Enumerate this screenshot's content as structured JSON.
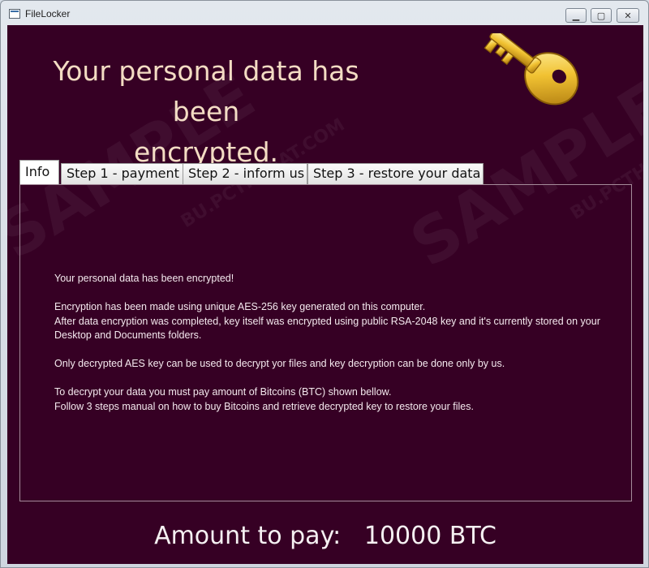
{
  "window": {
    "title": "FileLocker",
    "controls": {
      "minimize": "▁",
      "maximize": "▢",
      "close": "✕"
    }
  },
  "header": {
    "headline_line1": "Your personal data has been",
    "headline_line2": "encrypted."
  },
  "tabs": [
    {
      "label": "Info",
      "active": true
    },
    {
      "label": "Step 1 - payment",
      "active": false
    },
    {
      "label": "Step 2 - inform us",
      "active": false
    },
    {
      "label": "Step 3 - restore your data",
      "active": false
    }
  ],
  "info_panel": {
    "p1": "Your personal data has been encrypted!",
    "p2a": "Encryption has been made using unique AES-256 key generated on this computer.",
    "p2b": "After data encryption was completed, key itself was encrypted using public RSA-2048 key and it's currently stored on your Desktop and Documents folders.",
    "p3": "Only decrypted AES key can be used to decrypt yor files and key decryption can be done only by us.",
    "p4a": "To decrypt your data you must pay amount of Bitcoins (BTC) shown bellow.",
    "p4b": "Follow 3 steps manual on how to buy Bitcoins and retrieve decrypted key to restore your files."
  },
  "footer": {
    "amount_label": "Amount to pay:",
    "amount_value": "10000 BTC"
  },
  "watermark": {
    "text": "SAMPLE",
    "subtext": "BU.PCTHREAT.COM"
  },
  "colors": {
    "background": "#360024",
    "headline": "#f3dcc3",
    "body_text": "#f4e9ee",
    "key_gold": "#e8b21c"
  },
  "icons": {
    "app": "window-icon",
    "key": "gold-key-icon"
  }
}
